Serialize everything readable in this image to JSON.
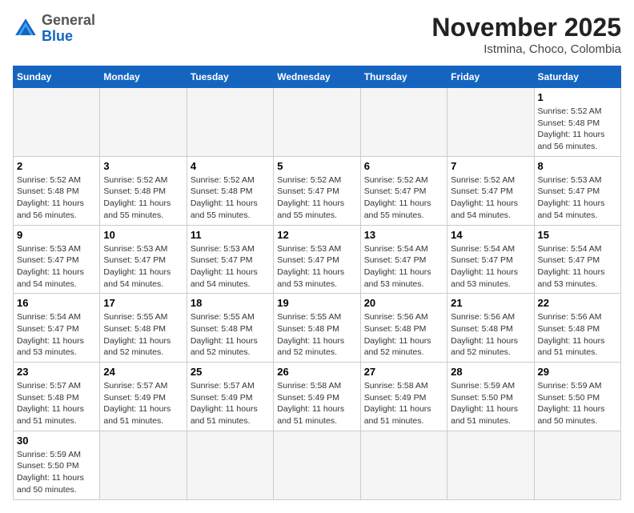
{
  "header": {
    "logo_general": "General",
    "logo_blue": "Blue",
    "month_title": "November 2025",
    "location": "Istmina, Choco, Colombia"
  },
  "days_of_week": [
    "Sunday",
    "Monday",
    "Tuesday",
    "Wednesday",
    "Thursday",
    "Friday",
    "Saturday"
  ],
  "weeks": [
    [
      {
        "day": "",
        "info": ""
      },
      {
        "day": "",
        "info": ""
      },
      {
        "day": "",
        "info": ""
      },
      {
        "day": "",
        "info": ""
      },
      {
        "day": "",
        "info": ""
      },
      {
        "day": "",
        "info": ""
      },
      {
        "day": "1",
        "info": "Sunrise: 5:52 AM\nSunset: 5:48 PM\nDaylight: 11 hours\nand 56 minutes."
      }
    ],
    [
      {
        "day": "2",
        "info": "Sunrise: 5:52 AM\nSunset: 5:48 PM\nDaylight: 11 hours\nand 56 minutes."
      },
      {
        "day": "3",
        "info": "Sunrise: 5:52 AM\nSunset: 5:48 PM\nDaylight: 11 hours\nand 55 minutes."
      },
      {
        "day": "4",
        "info": "Sunrise: 5:52 AM\nSunset: 5:48 PM\nDaylight: 11 hours\nand 55 minutes."
      },
      {
        "day": "5",
        "info": "Sunrise: 5:52 AM\nSunset: 5:47 PM\nDaylight: 11 hours\nand 55 minutes."
      },
      {
        "day": "6",
        "info": "Sunrise: 5:52 AM\nSunset: 5:47 PM\nDaylight: 11 hours\nand 55 minutes."
      },
      {
        "day": "7",
        "info": "Sunrise: 5:52 AM\nSunset: 5:47 PM\nDaylight: 11 hours\nand 54 minutes."
      },
      {
        "day": "8",
        "info": "Sunrise: 5:53 AM\nSunset: 5:47 PM\nDaylight: 11 hours\nand 54 minutes."
      }
    ],
    [
      {
        "day": "9",
        "info": "Sunrise: 5:53 AM\nSunset: 5:47 PM\nDaylight: 11 hours\nand 54 minutes."
      },
      {
        "day": "10",
        "info": "Sunrise: 5:53 AM\nSunset: 5:47 PM\nDaylight: 11 hours\nand 54 minutes."
      },
      {
        "day": "11",
        "info": "Sunrise: 5:53 AM\nSunset: 5:47 PM\nDaylight: 11 hours\nand 54 minutes."
      },
      {
        "day": "12",
        "info": "Sunrise: 5:53 AM\nSunset: 5:47 PM\nDaylight: 11 hours\nand 53 minutes."
      },
      {
        "day": "13",
        "info": "Sunrise: 5:54 AM\nSunset: 5:47 PM\nDaylight: 11 hours\nand 53 minutes."
      },
      {
        "day": "14",
        "info": "Sunrise: 5:54 AM\nSunset: 5:47 PM\nDaylight: 11 hours\nand 53 minutes."
      },
      {
        "day": "15",
        "info": "Sunrise: 5:54 AM\nSunset: 5:47 PM\nDaylight: 11 hours\nand 53 minutes."
      }
    ],
    [
      {
        "day": "16",
        "info": "Sunrise: 5:54 AM\nSunset: 5:47 PM\nDaylight: 11 hours\nand 53 minutes."
      },
      {
        "day": "17",
        "info": "Sunrise: 5:55 AM\nSunset: 5:48 PM\nDaylight: 11 hours\nand 52 minutes."
      },
      {
        "day": "18",
        "info": "Sunrise: 5:55 AM\nSunset: 5:48 PM\nDaylight: 11 hours\nand 52 minutes."
      },
      {
        "day": "19",
        "info": "Sunrise: 5:55 AM\nSunset: 5:48 PM\nDaylight: 11 hours\nand 52 minutes."
      },
      {
        "day": "20",
        "info": "Sunrise: 5:56 AM\nSunset: 5:48 PM\nDaylight: 11 hours\nand 52 minutes."
      },
      {
        "day": "21",
        "info": "Sunrise: 5:56 AM\nSunset: 5:48 PM\nDaylight: 11 hours\nand 52 minutes."
      },
      {
        "day": "22",
        "info": "Sunrise: 5:56 AM\nSunset: 5:48 PM\nDaylight: 11 hours\nand 51 minutes."
      }
    ],
    [
      {
        "day": "23",
        "info": "Sunrise: 5:57 AM\nSunset: 5:48 PM\nDaylight: 11 hours\nand 51 minutes."
      },
      {
        "day": "24",
        "info": "Sunrise: 5:57 AM\nSunset: 5:49 PM\nDaylight: 11 hours\nand 51 minutes."
      },
      {
        "day": "25",
        "info": "Sunrise: 5:57 AM\nSunset: 5:49 PM\nDaylight: 11 hours\nand 51 minutes."
      },
      {
        "day": "26",
        "info": "Sunrise: 5:58 AM\nSunset: 5:49 PM\nDaylight: 11 hours\nand 51 minutes."
      },
      {
        "day": "27",
        "info": "Sunrise: 5:58 AM\nSunset: 5:49 PM\nDaylight: 11 hours\nand 51 minutes."
      },
      {
        "day": "28",
        "info": "Sunrise: 5:59 AM\nSunset: 5:50 PM\nDaylight: 11 hours\nand 51 minutes."
      },
      {
        "day": "29",
        "info": "Sunrise: 5:59 AM\nSunset: 5:50 PM\nDaylight: 11 hours\nand 50 minutes."
      }
    ],
    [
      {
        "day": "30",
        "info": "Sunrise: 5:59 AM\nSunset: 5:50 PM\nDaylight: 11 hours\nand 50 minutes."
      },
      {
        "day": "",
        "info": ""
      },
      {
        "day": "",
        "info": ""
      },
      {
        "day": "",
        "info": ""
      },
      {
        "day": "",
        "info": ""
      },
      {
        "day": "",
        "info": ""
      },
      {
        "day": "",
        "info": ""
      }
    ]
  ]
}
